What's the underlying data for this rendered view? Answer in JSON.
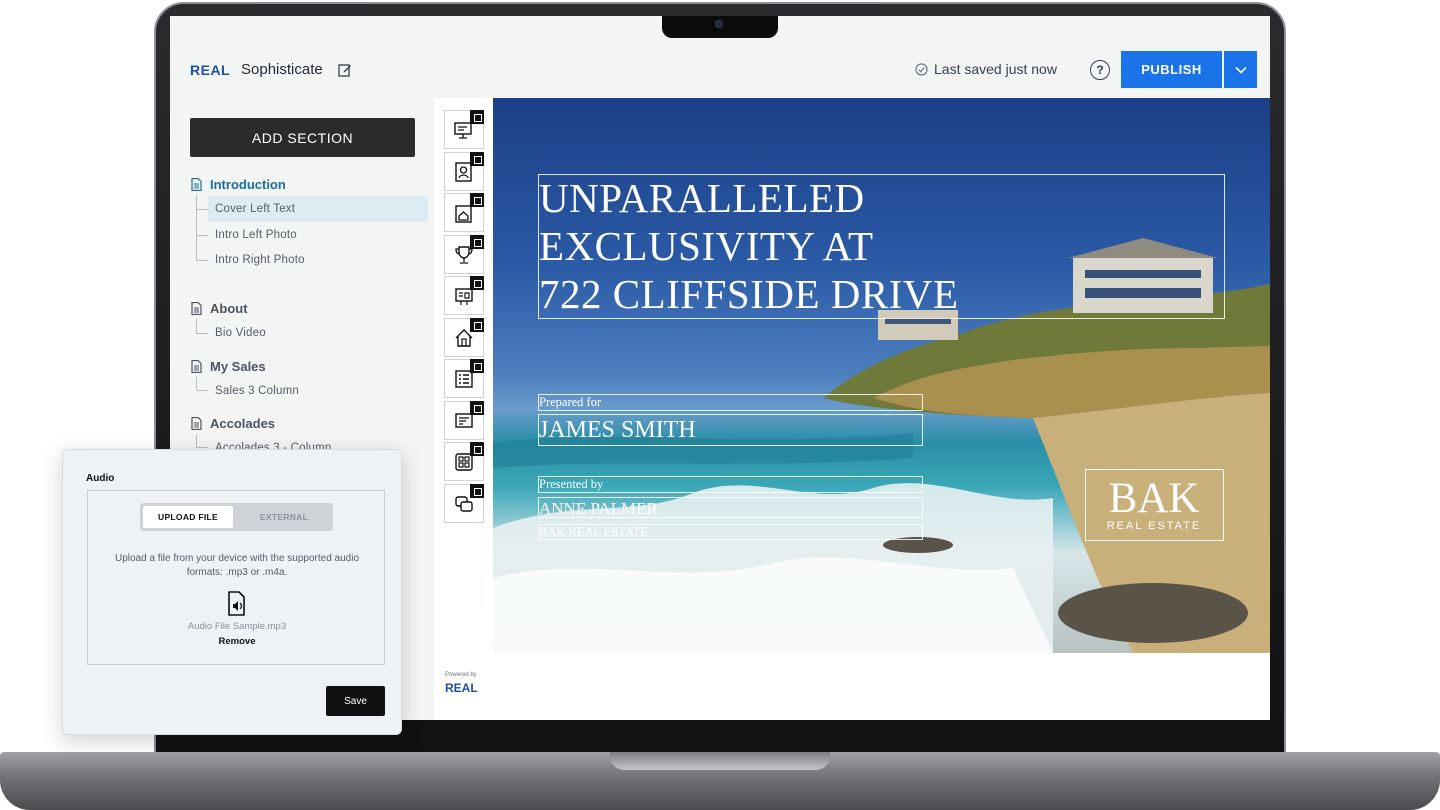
{
  "app": {
    "logo": "REAL",
    "document_title": "Sophisticate",
    "save_status": "Last saved just now",
    "help_icon": "question-circle-icon",
    "publish_label": "PUBLISH"
  },
  "sidebar": {
    "add_section_label": "ADD SECTION",
    "sections": [
      {
        "title": "Introduction",
        "active": true,
        "items": [
          "Cover Left Text",
          "Intro Left Photo",
          "Intro Right Photo"
        ],
        "selected_item": "Cover Left Text"
      },
      {
        "title": "About",
        "items": [
          "Bio Video"
        ]
      },
      {
        "title": "My Sales",
        "items": [
          "Sales 3 Column"
        ]
      },
      {
        "title": "Accolades",
        "items": [
          "Accolades 3 - Column"
        ]
      }
    ]
  },
  "thumbnails": [
    "slide-thumb-1",
    "slide-thumb-2",
    "slide-thumb-3",
    "slide-thumb-4",
    "slide-thumb-5",
    "slide-thumb-6",
    "slide-thumb-7",
    "slide-thumb-8",
    "slide-thumb-9",
    "slide-thumb-10"
  ],
  "powered_by": {
    "label": "Powered by",
    "logo": "REAL"
  },
  "slide": {
    "title_lines": [
      "UNPARALLELED",
      "EXCLUSIVITY AT",
      "722 CLIFFSIDE DRIVE"
    ],
    "prepared_for_label": "Prepared for",
    "client_name": "JAMES SMITH",
    "presented_by_label": "Presented by",
    "agent_name": "ANNE PALMER",
    "agency": "BAK REAL ESTATE",
    "brand_main": "BAK",
    "brand_sub": "REAL ESTATE"
  },
  "audio_panel": {
    "label": "Audio",
    "tab_upload": "UPLOAD FILE",
    "tab_external": "EXTERNAL",
    "active_tab": "UPLOAD FILE",
    "description": "Upload a file from your device with the supported audio formats: .mp3 or .m4a.",
    "file_name": "Audio File Sample.mp3",
    "remove_label": "Remove",
    "save_label": "Save"
  },
  "colors": {
    "accent": "#1a73e8",
    "active_section": "#1b6f9e",
    "selected_item_bg": "#dcecf2",
    "dark_button": "#2b2b2b"
  }
}
